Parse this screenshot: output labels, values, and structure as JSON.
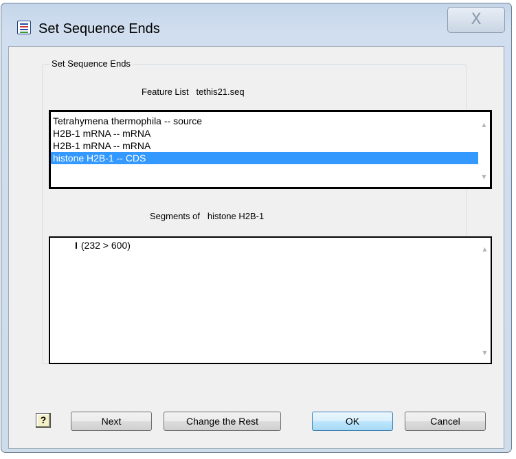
{
  "window": {
    "title": "Set Sequence Ends",
    "close_glyph": "X"
  },
  "group": {
    "legend": "Set Sequence Ends",
    "feature_list_caption": "Feature List",
    "feature_list_file": "tethis21.seq",
    "features": [
      "Tetrahymena thermophila -- source",
      "H2B-1 mRNA -- mRNA",
      "H2B-1 mRNA -- mRNA",
      "histone H2B-1 -- CDS"
    ],
    "selected_feature_index": 3,
    "segments_caption": "Segments of",
    "segments_of": "histone H2B-1",
    "segments": [
      {
        "mark": "I",
        "range": "(232 > 600)"
      }
    ]
  },
  "buttons": {
    "help_glyph": "?",
    "next": "Next",
    "change_rest": "Change the Rest",
    "ok": "OK",
    "cancel": "Cancel"
  },
  "icons": {
    "app": "document-list-icon",
    "close": "close-icon",
    "help": "help-icon",
    "scroll_up": "scroll-up-arrow-icon",
    "scroll_down": "scroll-down-arrow-icon"
  },
  "colors": {
    "selection": "#3399ff",
    "titlebar": "#c5d6ea",
    "client": "#f0f0f0"
  }
}
